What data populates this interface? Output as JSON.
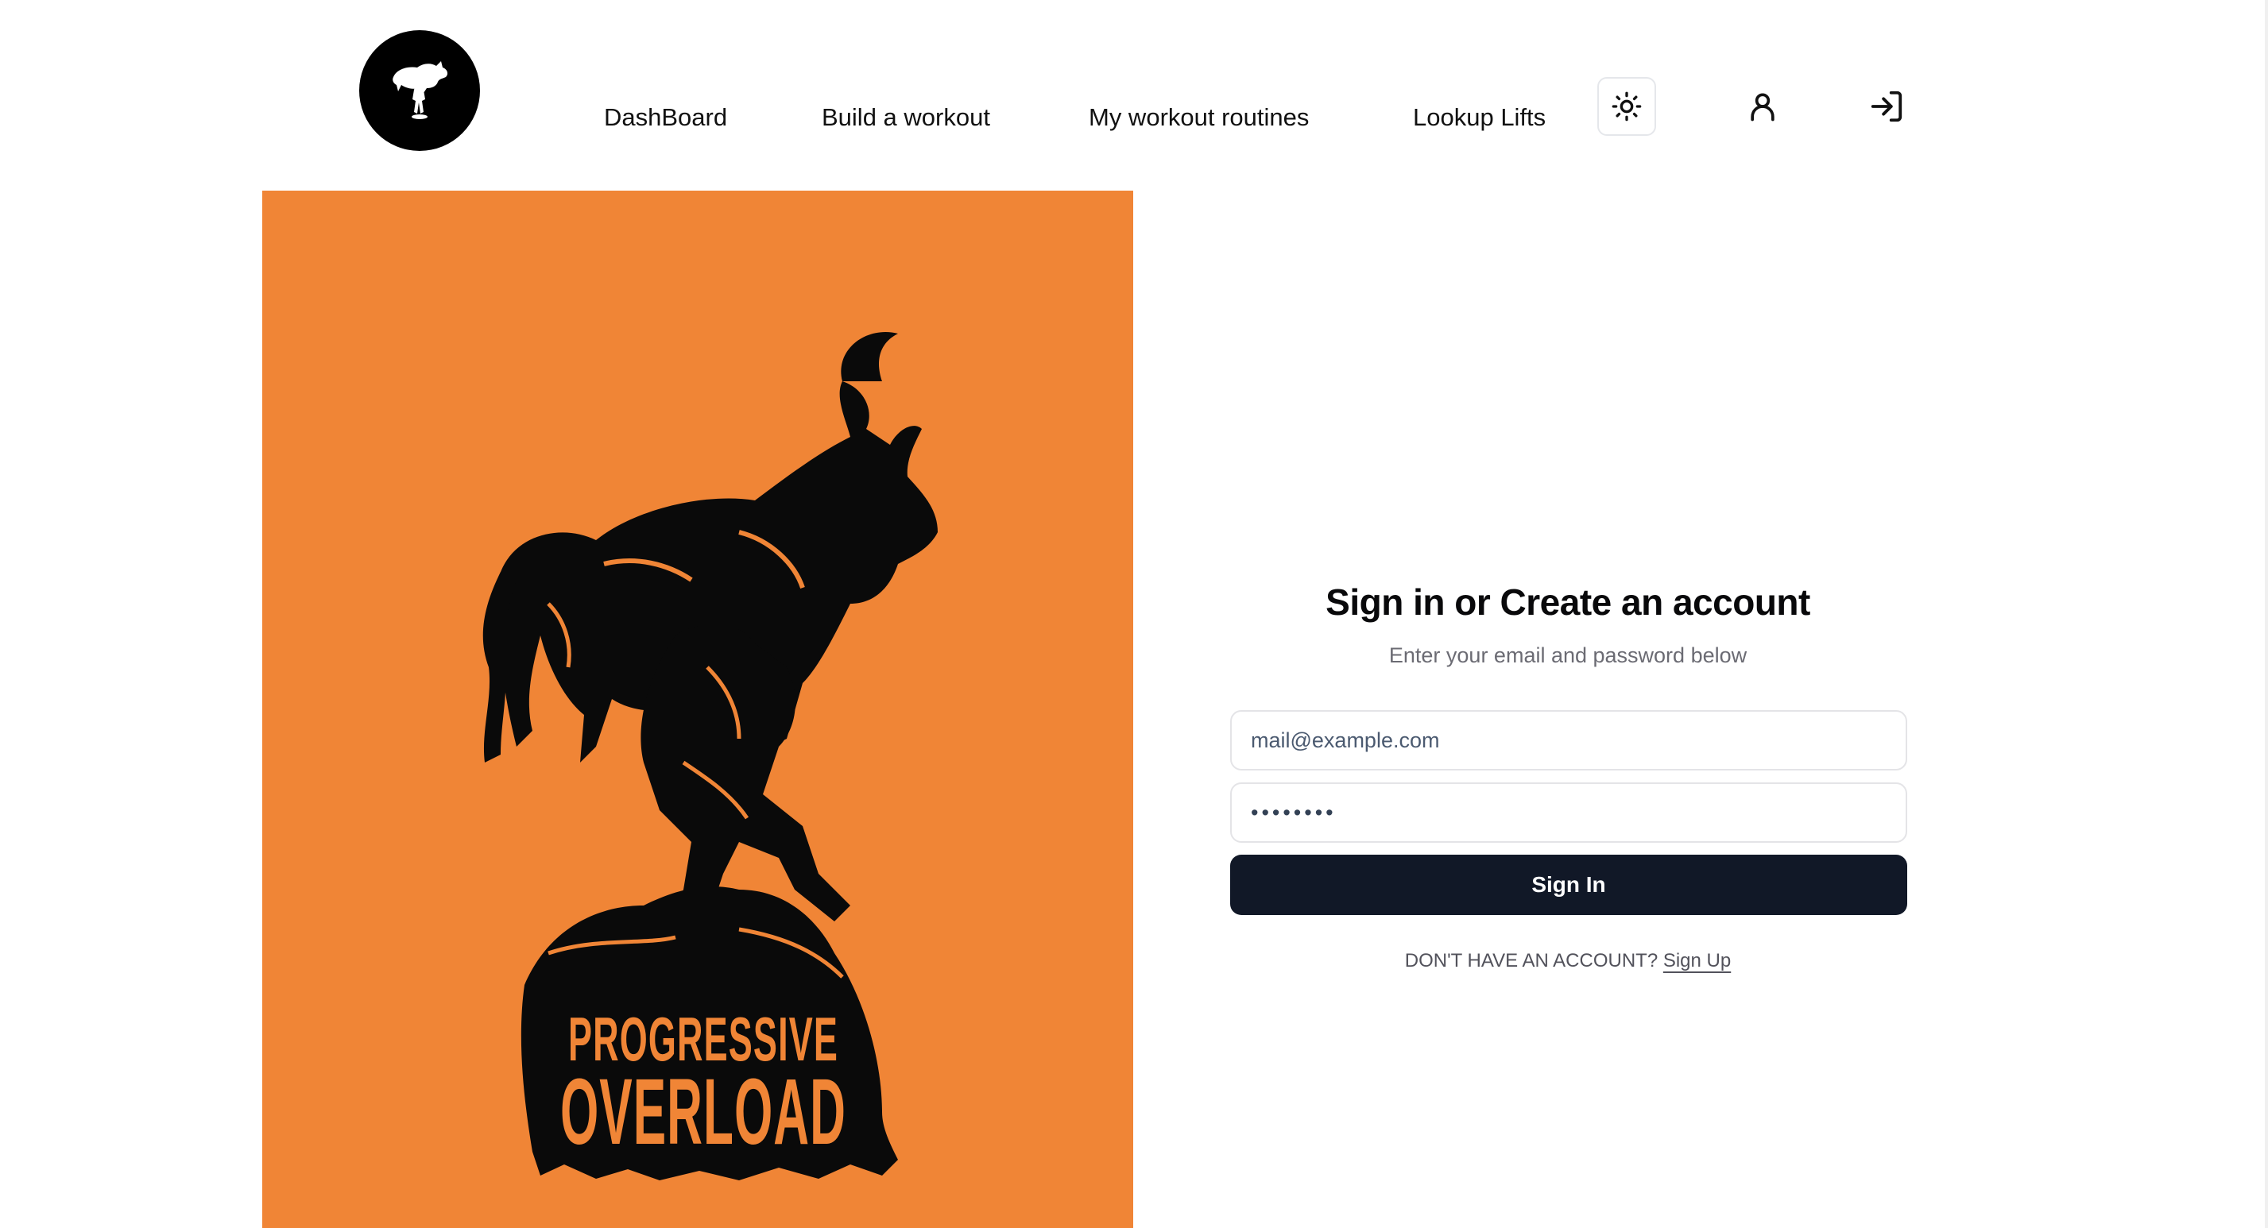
{
  "header": {
    "logo_alt": "Progressive Overload logo",
    "nav": [
      {
        "label": "DashBoard"
      },
      {
        "label": "Build a workout"
      },
      {
        "label": "My workout routines"
      },
      {
        "label": "Lookup Lifts"
      }
    ],
    "icons": [
      "sun-icon",
      "user-icon",
      "sign-in-icon"
    ]
  },
  "hero": {
    "background": "#f08536",
    "wordmark_line1": "PROGRESSIVE",
    "wordmark_line2": "OVERLOAD"
  },
  "auth": {
    "title": "Sign in or Create an account",
    "subtitle": "Enter your email and password below",
    "email_placeholder": "mail@example.com",
    "password_value": "••••••••",
    "signin_label": "Sign In",
    "no_account_text": "DON'T HAVE AN ACCOUNT?",
    "signup_label": "Sign Up"
  },
  "colors": {
    "accent": "#f08536",
    "button": "#111827"
  }
}
